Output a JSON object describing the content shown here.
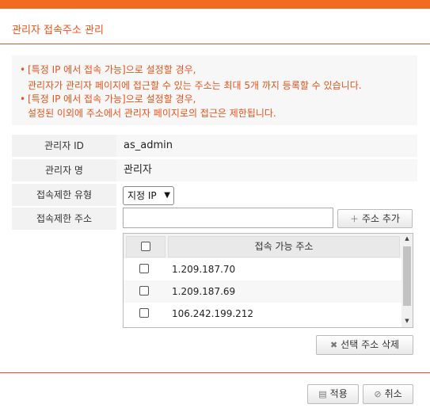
{
  "dialog": {
    "title": "관리자 접속주소 관리"
  },
  "notice": {
    "bullet": "•",
    "lines": [
      "[특정 IP 에서 접속 가능]으로 설정할 경우,",
      "관리자가 관리자 페이지에 접근할 수 있는 주소는 최대 5개 까지 등록할 수 있습니다.",
      "[특정 IP 에서 접속 가능]으로 설정할 경우,",
      "설정된 이외에 주소에서 관리자 페이지로의 접근은 제한됩니다."
    ]
  },
  "form": {
    "admin_id": {
      "label": "관리자 ID",
      "value": "as_admin"
    },
    "admin_name": {
      "label": "관리자 명",
      "value": "관리자"
    },
    "restriction_type": {
      "label": "접속제한 유형",
      "selected": "지정 IP"
    },
    "restriction_address": {
      "label": "접속제한 주소",
      "input_value": "",
      "add_button": "주소 추가"
    }
  },
  "ip_table": {
    "header": "접속 가능 주소",
    "rows": [
      "1.209.187.70",
      "1.209.187.69",
      "106.242.199.212"
    ]
  },
  "delete_button": "선택 주소 삭제",
  "footer": {
    "apply": "적용",
    "cancel": "취소"
  },
  "colors": {
    "accent": "#f26b21",
    "notice_text": "#e8531b"
  },
  "icons": {
    "add": "plus-icon",
    "delete": "x-icon",
    "apply": "save-icon",
    "cancel": "cancel-circle-icon"
  }
}
